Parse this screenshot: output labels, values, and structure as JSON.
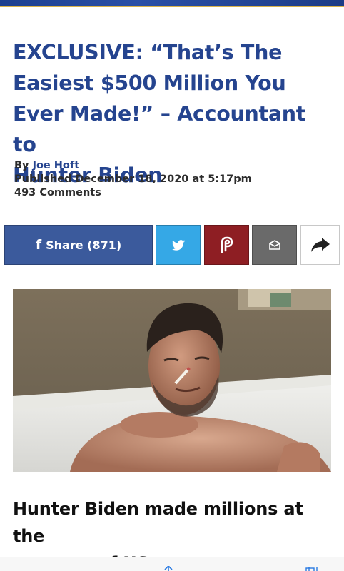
{
  "article": {
    "headline_lines": [
      "EXCLUSIVE: “That’s The",
      "Easiest $500 Million You",
      "Ever Made!” – Accountant to",
      "Hunter Biden"
    ],
    "by_prefix": "By ",
    "author": "Joe Hoft",
    "published": "Published December 18, 2020 at 5:17pm",
    "comments": "493 Comments",
    "subhead_lines": [
      "Hunter Biden made millions at the",
      "expense of US taxpayers."
    ]
  },
  "share": {
    "facebook_label": "Share (871)",
    "facebook_icon": "f",
    "buttons": [
      "facebook-icon",
      "twitter-icon",
      "parler-icon",
      "email-icon",
      "share-arrow-icon"
    ]
  },
  "colors": {
    "headline": "#25448f",
    "facebook": "#3b5a9c",
    "twitter": "#35a8e6",
    "parler": "#8e1e23",
    "email": "#6a6a6a"
  }
}
